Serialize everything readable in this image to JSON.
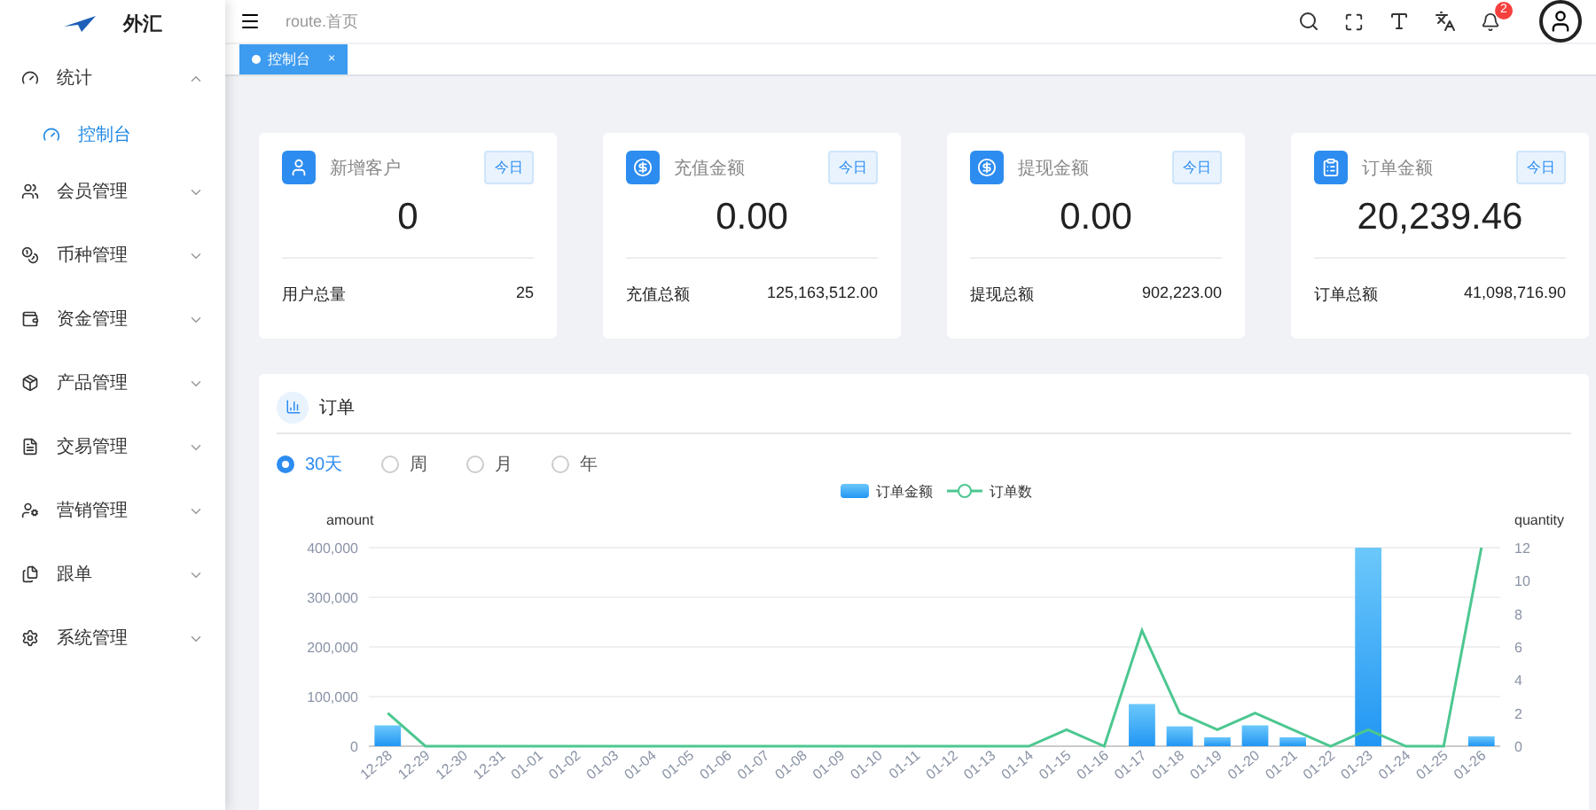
{
  "sidebar": {
    "brand": "外汇",
    "items": [
      {
        "label": "统计",
        "expanded": true,
        "children": [
          {
            "label": "控制台",
            "selected": true
          }
        ]
      },
      {
        "label": "会员管理",
        "expanded": false
      },
      {
        "label": "币种管理",
        "expanded": false
      },
      {
        "label": "资金管理",
        "expanded": false
      },
      {
        "label": "产品管理",
        "expanded": false
      },
      {
        "label": "交易管理",
        "expanded": false
      },
      {
        "label": "营销管理",
        "expanded": false
      },
      {
        "label": "跟单",
        "expanded": false
      },
      {
        "label": "系统管理",
        "expanded": false
      }
    ]
  },
  "header": {
    "breadcrumb": "route.首页",
    "notification_count": "2"
  },
  "tabs": [
    {
      "label": "控制台",
      "close": "×",
      "selected": true
    }
  ],
  "stat_cards": [
    {
      "title": "新增客户",
      "badge": "今日",
      "value": "0",
      "footer_label": "用户总量",
      "footer_value": "25"
    },
    {
      "title": "充值金额",
      "badge": "今日",
      "value": "0.00",
      "footer_label": "充值总额",
      "footer_value": "125,163,512.00"
    },
    {
      "title": "提现金额",
      "badge": "今日",
      "value": "0.00",
      "footer_label": "提现总额",
      "footer_value": "902,223.00"
    },
    {
      "title": "订单金额",
      "badge": "今日",
      "value": "20,239.46",
      "footer_label": "订单总额",
      "footer_value": "41,098,716.90"
    }
  ],
  "orders_panel": {
    "title": "订单",
    "periods": [
      {
        "label": "30天",
        "selected": true
      },
      {
        "label": "周",
        "selected": false
      },
      {
        "label": "月",
        "selected": false
      },
      {
        "label": "年",
        "selected": false
      }
    ],
    "chart_data": {
      "type": "bar",
      "grid": true,
      "legend": "top",
      "ylabel": "amount",
      "y2label": "quantity",
      "categories": [
        "12-28",
        "12-29",
        "12-30",
        "12-31",
        "01-01",
        "01-02",
        "01-03",
        "01-04",
        "01-05",
        "01-06",
        "01-07",
        "01-08",
        "01-09",
        "01-10",
        "01-11",
        "01-12",
        "01-13",
        "01-14",
        "01-15",
        "01-16",
        "01-17",
        "01-18",
        "01-19",
        "01-20",
        "01-21",
        "01-22",
        "01-23",
        "01-24",
        "01-25",
        "01-26"
      ],
      "series": [
        {
          "name": "订单金额",
          "color": "#2196f3",
          "values": [
            42000,
            0,
            0,
            0,
            0,
            0,
            0,
            0,
            0,
            0,
            0,
            0,
            0,
            0,
            0,
            0,
            0,
            0,
            0,
            0,
            85000,
            40000,
            18000,
            42000,
            18000,
            0,
            400000,
            0,
            0,
            20000
          ]
        },
        {
          "name": "订单数",
          "type": "line",
          "axis": "y2",
          "color": "#4cc790",
          "values": [
            2,
            0,
            0,
            0,
            0,
            0,
            0,
            0,
            0,
            0,
            0,
            0,
            0,
            0,
            0,
            0,
            0,
            0,
            1,
            0,
            7,
            2,
            1,
            2,
            1,
            0,
            1,
            0,
            0,
            12
          ]
        }
      ],
      "ylim": [
        0,
        400000
      ],
      "yticks": [
        {
          "value": 0,
          "label": "0"
        },
        {
          "value": 100000,
          "label": "100,000"
        },
        {
          "value": 200000,
          "label": "200,000"
        },
        {
          "value": 300000,
          "label": "300,000"
        },
        {
          "value": 400000,
          "label": "400,000"
        }
      ],
      "y2lim": [
        0,
        12
      ],
      "y2ticks": [
        0,
        2,
        4,
        6,
        8,
        10,
        12
      ]
    }
  }
}
